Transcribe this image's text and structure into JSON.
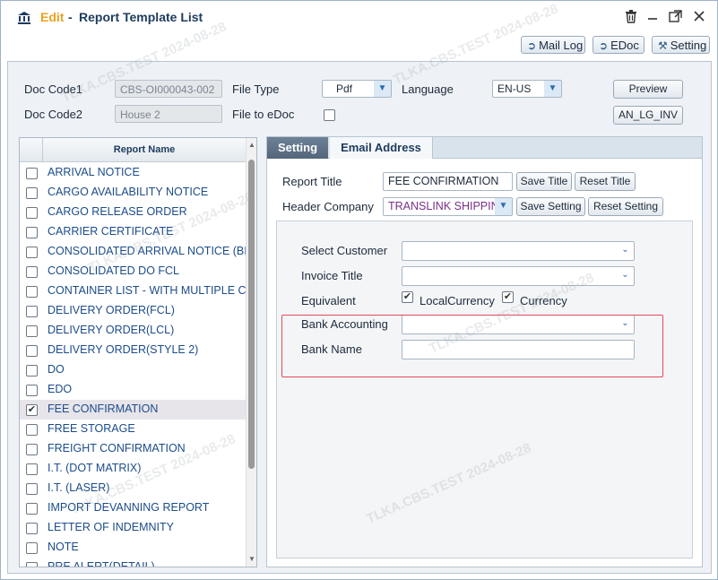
{
  "window": {
    "title_mode": "Edit",
    "title_separator": "-",
    "title": "Report Template List",
    "controls": [
      "trash-icon",
      "minimize-icon",
      "maximize-icon",
      "close-icon"
    ]
  },
  "toolbar": {
    "mail_log": "Mail Log",
    "edoc": "EDoc",
    "setting": "Setting"
  },
  "form": {
    "doc_code1_label": "Doc Code1",
    "doc_code1_value": "CBS-OI000043-002",
    "doc_code2_label": "Doc Code2",
    "doc_code2_value": "House 2",
    "file_type_label": "File Type",
    "file_type_value": "Pdf",
    "file_to_edoc_label": "File to eDoc",
    "language_label": "Language",
    "language_value": "EN-US",
    "preview_button": "Preview",
    "an_lg_inv_button": "AN_LG_INV"
  },
  "report_list": {
    "header": "Report Name",
    "items": [
      {
        "name": "ARRIVAL NOTICE",
        "checked": false
      },
      {
        "name": "CARGO AVAILABILITY NOTICE",
        "checked": false
      },
      {
        "name": "CARGO RELEASE ORDER",
        "checked": false
      },
      {
        "name": "CARRIER CERTIFICATE",
        "checked": false
      },
      {
        "name": "CONSOLIDATED ARRIVAL NOTICE (BIL",
        "checked": false
      },
      {
        "name": "CONSOLIDATED DO FCL",
        "checked": false
      },
      {
        "name": "CONTAINER LIST - WITH MULTIPLE CO",
        "checked": false
      },
      {
        "name": "DELIVERY ORDER(FCL)",
        "checked": false
      },
      {
        "name": "DELIVERY ORDER(LCL)",
        "checked": false
      },
      {
        "name": "DELIVERY ORDER(STYLE 2)",
        "checked": false
      },
      {
        "name": "DO",
        "checked": false
      },
      {
        "name": "EDO",
        "checked": false
      },
      {
        "name": "FEE CONFIRMATION",
        "checked": true
      },
      {
        "name": "FREE STORAGE",
        "checked": false
      },
      {
        "name": "FREIGHT CONFIRMATION",
        "checked": false
      },
      {
        "name": "I.T. (DOT MATRIX)",
        "checked": false
      },
      {
        "name": "I.T. (LASER)",
        "checked": false
      },
      {
        "name": "IMPORT DEVANNING REPORT",
        "checked": false
      },
      {
        "name": "LETTER OF INDEMNITY",
        "checked": false
      },
      {
        "name": "NOTE",
        "checked": false
      },
      {
        "name": "PRE ALERT(DETAIL)",
        "checked": false
      }
    ]
  },
  "tabs": {
    "setting": "Setting",
    "email_address": "Email Address"
  },
  "setting": {
    "report_title_label": "Report Title",
    "report_title_value": "FEE CONFIRMATION",
    "save_title": "Save Title",
    "reset_title": "Reset Title",
    "header_company_label": "Header Company",
    "header_company_value": "TRANSLINK SHIPPIN",
    "save_setting": "Save Setting",
    "reset_setting": "Reset Setting",
    "select_customer_label": "Select Customer",
    "select_customer_value": "",
    "invoice_title_label": "Invoice Title",
    "invoice_title_value": "",
    "equivalent_label": "Equivalent",
    "local_currency_label": "LocalCurrency",
    "local_currency_checked": true,
    "currency_label": "Currency",
    "currency_checked": true,
    "bank_accounting_label": "Bank Accounting",
    "bank_accounting_value": "",
    "bank_name_label": "Bank Name",
    "bank_name_value": ""
  },
  "watermark": "TLKA.CBS.TEST 2024-08-28",
  "colors": {
    "accent_title": "#e8a21c",
    "link_text": "#1c4c8a",
    "highlight_border": "#e8485a",
    "active_tab": "#5e7287"
  }
}
